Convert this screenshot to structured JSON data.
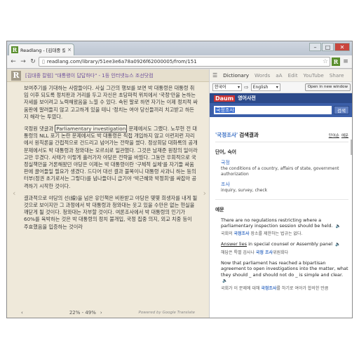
{
  "browser": {
    "tab_title": "Readlang - [김대중 칼럼] \"대통령이 답답하다\" -",
    "tab_close": "×",
    "favicon_letter": "R",
    "url": "readlang.com/library/51ee3e6a78a0926f62000005/from/151",
    "win_min": "–",
    "win_max": "□",
    "win_close": "✕",
    "ext_letter": "R"
  },
  "reader": {
    "logo_letter": "R",
    "title": "[김대중 칼럼] \"대통령이 답답하다\" - 1등 인터넷뉴스 조선닷컴",
    "paragraph1": "보여주기를 기대하는 사람들이다. 사실 그간의 행보를 보면 박 대통령은 대통령 취임 이후 되도록 정치판과 거리를 두고 자신은 초당파적 위치에서 '국정'만을 논하는 자세를 보이려고 노력해왔음을 느낄 수 있다. 속된 말로 하면 자기는 이제 정치적 싸움판에 말려들지 않고 고고하게 있을 테니 '정치는 여야 당신들끼리 치고받고 하든지 해라'는 투였다.",
    "paragraph2_before": "국정원 댓글과",
    "paragraph2_highlight": "Parliamentary investigation",
    "paragraph2_after": "문제에서도 그랬다. 노무현 전 대통령의 NLL 포기 논란 문제에서도 박 대통령은 직접 개입하지 않고 이런저런 자리에서 원칙론을 간접적으로 건드리고 넘어가는 전략을 썼다. 정상회담 대화록의 공개 문제에서도 박 대통령과 청와대는 모르쇠로 일관했다. 그것은 남재준 원장의 일이라고만 우겼다. 사태가 이렇게 흘러가자 야당은 전략을 바꿨다. 그동안 우회적으로 국정실책만을 거론해왔던 야당은 이제는 박 대통령이란 '구체적 실체'를 자기들 싸움판에 끌어들일 필요가 생겼다. 드디어 대선 결과 불복이니 대통령 사과니 하는 등의 터부(정권 초기로서는 그렇다)를 넘나들더니 급기야 '박근혜와 박정희'를 싸잡아 공격하기 시작한 것이다.",
    "paragraph3": "결과적으로 야당의 선(線)을 넘은 유인책은 비판받고 야당은 몇몇 희생자를 내게 될 것으로 보이지만 그 과정에서 박 대통령과 청와대는 웃고 있을 수만은 없는 현실을 깨닫게 될 것이다. 청와대는 자부할 것이다. 여론조사에서 박 대통령의 인기가 60%를 육박하는 것은 박 대통령의 정치 불개입, 국정 집중 의지, 외교 치중 등이 주효했음을 입증하는 것이라",
    "arrow_left": "‹",
    "arrow_right": "›",
    "footer_left": "‹",
    "footer_right": "›",
    "progress": "22% - 49%",
    "powered": "Powered by Google Translate"
  },
  "dict_tabs": {
    "menu": "☰",
    "dictionary": "Dictionary",
    "words": "Words",
    "font": "aA",
    "edit": "Edit",
    "youtube": "YouTube",
    "share": "Share"
  },
  "lang": {
    "from": "한국어",
    "to": "English",
    "swap": "⇨",
    "open_button": "Open in new window"
  },
  "daum": {
    "logo": "Daum",
    "title": "영어사전",
    "search_value": "국정조사",
    "search_button": "검색"
  },
  "result": {
    "keyword": "'국정조사'",
    "suffix": "검색결과",
    "filter1": "단어순",
    "filter2": "예문"
  },
  "words_section": {
    "title": "단어, 숙어",
    "items": [
      {
        "word": "국정",
        "meaning": "the conditions of a country, affairs of state, government authorization"
      },
      {
        "word": "조사",
        "meaning": "inquiry, survey, check"
      }
    ]
  },
  "examples_section": {
    "title": "예문",
    "ex1_en": "There are no regulations restricting where a parliamentary inspection session should be held.",
    "ex1_ko_before": "국회의",
    "ex1_ko_kw": "국정조사",
    "ex1_ko_after": "장소를 제한하는 법규는 없다.",
    "ex2_en_u": "Answer lies",
    "ex2_en_rest": "in special counsel or Assembly panel",
    "ex2_ko_before": "해답은 특별 검사나",
    "ex2_ko_kw": "국정 조사",
    "ex2_ko_after": "위원회다",
    "ex3_en": "Now that parliament has reached a bipartisan agreement to open investigations into the matter, what they should _ and should not do _ is simple and clear.",
    "ex3_ko_before": "국회가 이 문제에 대해",
    "ex3_ko_kw": "국정조사",
    "ex3_ko_after": "를 하기로 여야가 합의한 만큼"
  },
  "icons": {
    "speaker": "🔈"
  }
}
